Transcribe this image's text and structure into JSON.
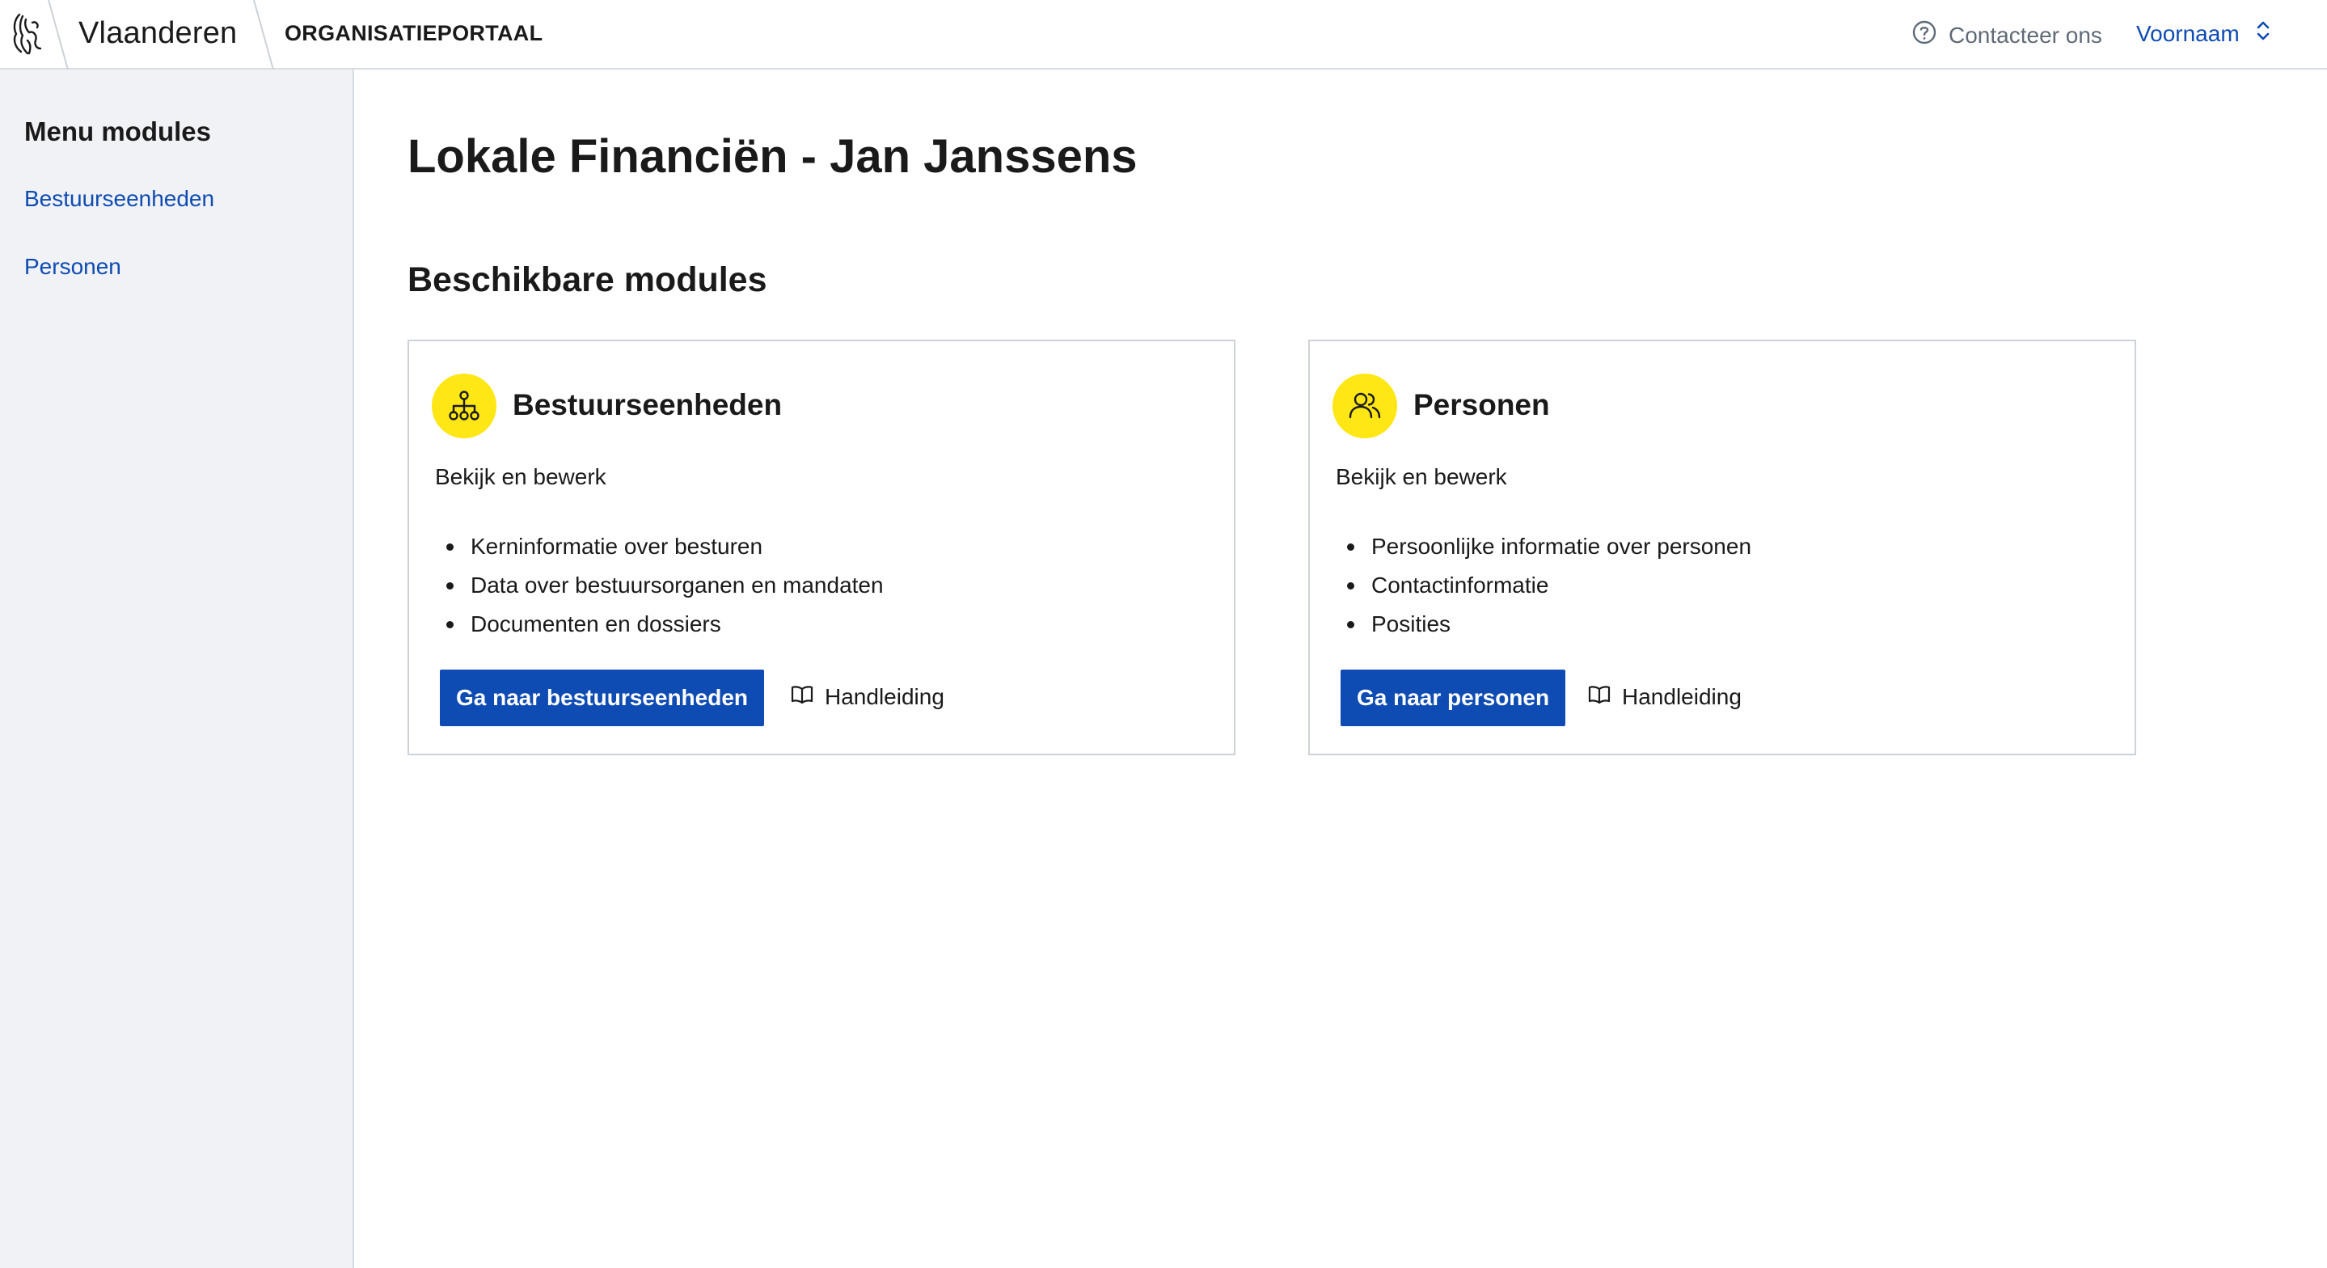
{
  "header": {
    "brand": "Vlaanderen",
    "portal": "ORGANISATIEPORTAAL",
    "contact_label": "Contacteer ons",
    "user_name": "Voornaam"
  },
  "sidebar": {
    "title": "Menu modules",
    "items": [
      {
        "label": "Bestuurseenheden"
      },
      {
        "label": "Personen"
      }
    ]
  },
  "main": {
    "title": "Lokale Financiën - Jan Janssens",
    "section_title": "Beschikbare modules",
    "cards": [
      {
        "title": "Bestuurseenheden",
        "icon": "org-chart-icon",
        "subtitle": "Bekijk en bewerk",
        "items": [
          "Kerninformatie over besturen",
          "Data over bestuursorganen en mandaten",
          "Documenten en dossiers"
        ],
        "button_label": "Ga naar bestuurseenheden",
        "manual_label": "Handleiding"
      },
      {
        "title": "Personen",
        "icon": "users-icon",
        "subtitle": "Bekijk en bewerk",
        "items": [
          "Persoonlijke informatie over personen",
          "Contactinformatie",
          "Posities"
        ],
        "button_label": "Ga naar personen",
        "manual_label": "Handleiding"
      }
    ]
  },
  "colors": {
    "accent_blue": "#0e4bb3",
    "icon_yellow": "#ffe615",
    "sidebar_bg": "#f0f2f5"
  }
}
